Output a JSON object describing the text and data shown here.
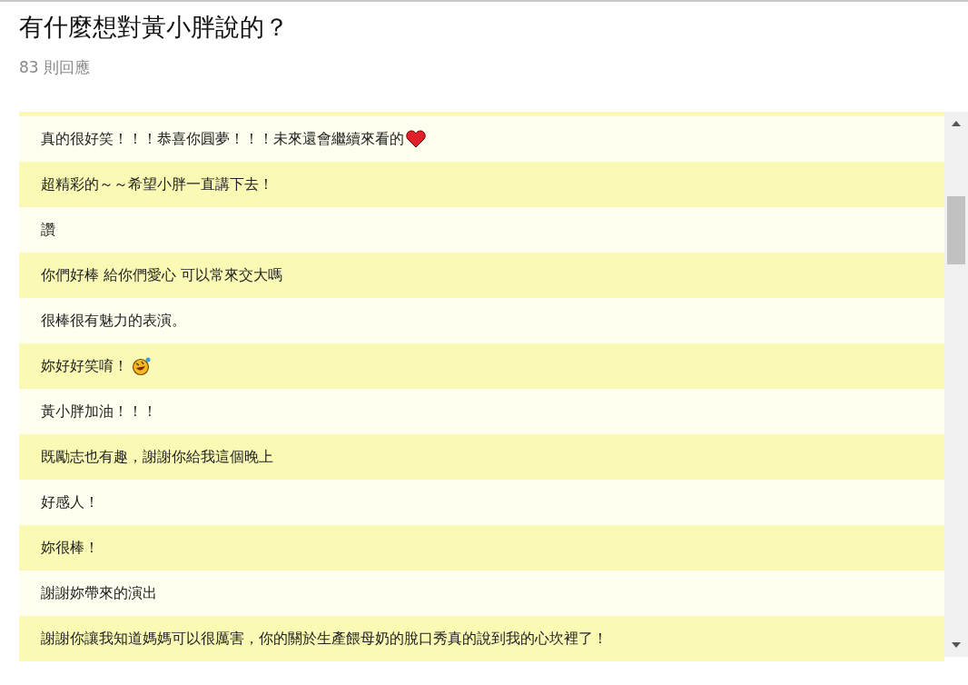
{
  "title": "有什麼想對黃小胖說的？",
  "reply_count": "83 則回應",
  "comments": [
    {
      "text": "真的很好笑！！！恭喜你圓夢！！！未來還會繼續來看的",
      "kind": "heart"
    },
    {
      "text": "超精彩的～～希望小胖一直講下去！"
    },
    {
      "text": "讚"
    },
    {
      "text": "你們好棒 給你們愛心 可以常來交大嗎"
    },
    {
      "text": "很棒很有魅力的表演。"
    },
    {
      "text": "妳好好笑唷！",
      "kind": "laughing"
    },
    {
      "text": "黃小胖加油！！！"
    },
    {
      "text": "既勵志也有趣，謝謝你給我這個晚上"
    },
    {
      "text": "好感人！"
    },
    {
      "text": "妳很棒！"
    },
    {
      "text": "謝謝妳帶來的演出"
    },
    {
      "text": "謝謝你讓我知道媽媽可以很厲害，你的關於生產餵母奶的脫口秀真的說到我的心坎裡了！"
    }
  ]
}
